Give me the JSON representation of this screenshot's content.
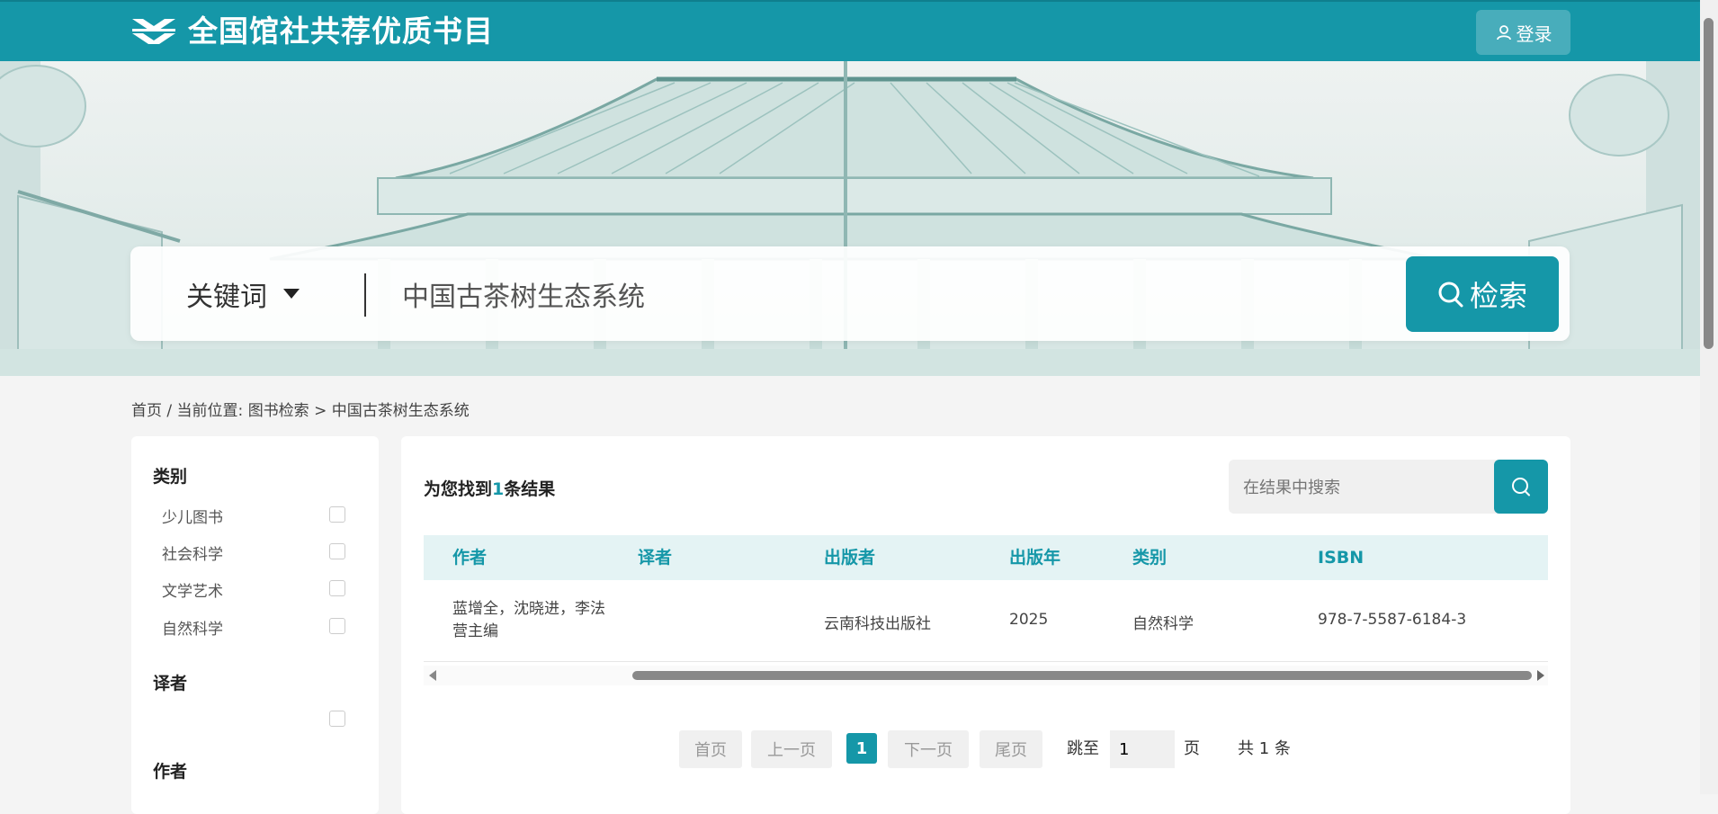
{
  "header": {
    "site_title": "全国馆社共荐优质书目",
    "login_label": "登录"
  },
  "search": {
    "type_label": "关键词",
    "query": "中国古茶树生态系统",
    "button_label": "检索"
  },
  "breadcrumb": {
    "home": "首页",
    "sep1": " / ",
    "location_label": "当前位置: ",
    "section": "图书检索",
    "sep2": " > ",
    "current": "中国古茶树生态系统"
  },
  "filters": {
    "category_title": "类别",
    "categories": [
      "少儿图书",
      "社会科学",
      "文学艺术",
      "自然科学"
    ],
    "translator_title": "译者",
    "author_title": "作者"
  },
  "results": {
    "found_prefix": "为您找到",
    "found_count": "1",
    "found_suffix": "条结果",
    "inner_search_placeholder": "在结果中搜索",
    "columns": [
      "作者",
      "译者",
      "出版者",
      "出版年",
      "类别",
      "ISBN"
    ],
    "rows": [
      {
        "author": "蓝增全，沈晓进，李法营主编",
        "translator": "",
        "publisher": "云南科技出版社",
        "year": "2025",
        "category": "自然科学",
        "isbn": "978-7-5587-6184-3"
      }
    ]
  },
  "pagination": {
    "first": "首页",
    "prev": "上一页",
    "current": "1",
    "next": "下一页",
    "last": "尾页",
    "jump_label": "跳至",
    "jump_value": "1",
    "page_unit": "页",
    "total": "共 1 条"
  },
  "colors": {
    "brand": "#1597a8",
    "table_header_bg": "#e4f3f4"
  }
}
